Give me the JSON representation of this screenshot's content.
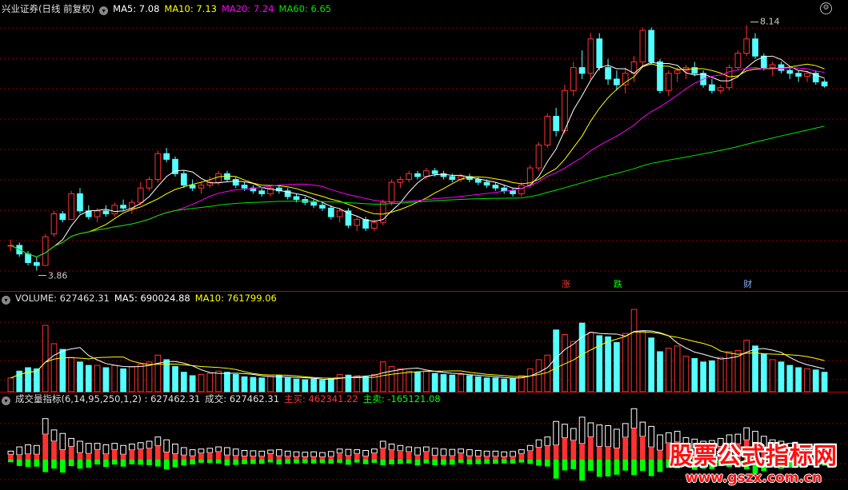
{
  "colors": {
    "up": "#ff3232",
    "down": "#54ffff",
    "ma5": "#ffffff",
    "ma10": "#ffff00",
    "ma20": "#ff00ff",
    "ma60": "#00e600",
    "grid": "#8b0000",
    "divider": "#c80000",
    "label_up": "#ff3232",
    "label_down": "#00ff00",
    "label_neutral": "#cccccc"
  },
  "price_header": {
    "title": "兴业证券(日线 前复权)",
    "ma5": "MA5: 7.08",
    "ma10": "MA10: 7.13",
    "ma20": "MA20: 7.24",
    "ma60": "MA60: 6.65"
  },
  "volume_header": {
    "label": "VOLUME: 627462.31",
    "ma5": "MA5: 690024.88",
    "ma10": "MA10: 761799.06"
  },
  "indicator_header": {
    "name": "成交量指标(6,14,95,250,1,2) : 627462.31",
    "volume": "成交: 627462.31",
    "buy": "主买: 462341.22",
    "sell": "主卖: -165121.08"
  },
  "icons": {
    "collapse": "chevron-down-icon",
    "settings": "gear-icon"
  },
  "events": [
    {
      "index": 64,
      "text": "涨",
      "color": "#ff3232"
    },
    {
      "index": 70,
      "text": "跌",
      "color": "#00ff00"
    },
    {
      "index": 85,
      "text": "财",
      "color": "#8ab0ff"
    }
  ],
  "watermark": {
    "main": "股票公式指标网",
    "url": "www.gszx.com.cn"
  },
  "chart_data": {
    "type": "candlestick",
    "price_ylim": [
      3.7,
      8.3
    ],
    "high_marker": {
      "index": 86,
      "value": 8.14,
      "label": "8.14"
    },
    "low_marker": {
      "index": 3,
      "value": 3.86,
      "label": "3.86"
    },
    "ohlc": [
      [
        4.3,
        4.4,
        4.2,
        4.3
      ],
      [
        4.3,
        4.35,
        4.1,
        4.15
      ],
      [
        4.15,
        4.2,
        3.95,
        4.0
      ],
      [
        4.0,
        4.1,
        3.86,
        3.95
      ],
      [
        3.95,
        4.5,
        3.95,
        4.45
      ],
      [
        4.5,
        4.9,
        4.45,
        4.85
      ],
      [
        4.85,
        4.9,
        4.7,
        4.75
      ],
      [
        4.75,
        5.25,
        4.75,
        5.2
      ],
      [
        5.2,
        5.3,
        4.85,
        4.9
      ],
      [
        4.9,
        5.0,
        4.75,
        4.8
      ],
      [
        4.8,
        4.95,
        4.7,
        4.9
      ],
      [
        4.9,
        5.0,
        4.8,
        4.85
      ],
      [
        4.85,
        5.05,
        4.8,
        5.0
      ],
      [
        5.0,
        5.1,
        4.9,
        4.95
      ],
      [
        4.95,
        5.1,
        4.85,
        5.05
      ],
      [
        5.05,
        5.4,
        5.0,
        5.3
      ],
      [
        5.3,
        5.5,
        5.25,
        5.45
      ],
      [
        5.45,
        5.95,
        5.4,
        5.9
      ],
      [
        5.9,
        6.0,
        5.75,
        5.8
      ],
      [
        5.8,
        5.85,
        5.5,
        5.55
      ],
      [
        5.55,
        5.6,
        5.3,
        5.35
      ],
      [
        5.35,
        5.45,
        5.25,
        5.3
      ],
      [
        5.3,
        5.4,
        5.2,
        5.35
      ],
      [
        5.35,
        5.5,
        5.3,
        5.4
      ],
      [
        5.4,
        5.6,
        5.35,
        5.55
      ],
      [
        5.55,
        5.6,
        5.4,
        5.45
      ],
      [
        5.45,
        5.5,
        5.3,
        5.35
      ],
      [
        5.35,
        5.4,
        5.25,
        5.3
      ],
      [
        5.3,
        5.35,
        5.2,
        5.25
      ],
      [
        5.25,
        5.3,
        5.15,
        5.2
      ],
      [
        5.2,
        5.35,
        5.15,
        5.3
      ],
      [
        5.3,
        5.35,
        5.2,
        5.25
      ],
      [
        5.25,
        5.3,
        5.1,
        5.15
      ],
      [
        5.15,
        5.2,
        5.05,
        5.1
      ],
      [
        5.1,
        5.15,
        5.0,
        5.05
      ],
      [
        5.05,
        5.1,
        4.95,
        5.0
      ],
      [
        5.0,
        5.05,
        4.9,
        4.95
      ],
      [
        4.95,
        5.0,
        4.75,
        4.8
      ],
      [
        4.8,
        4.95,
        4.7,
        4.9
      ],
      [
        4.9,
        4.95,
        4.6,
        4.65
      ],
      [
        4.65,
        4.8,
        4.55,
        4.75
      ],
      [
        4.75,
        4.8,
        4.55,
        4.6
      ],
      [
        4.6,
        4.75,
        4.55,
        4.7
      ],
      [
        4.7,
        5.1,
        4.65,
        5.05
      ],
      [
        5.05,
        5.45,
        5.0,
        5.4
      ],
      [
        5.4,
        5.5,
        5.3,
        5.45
      ],
      [
        5.45,
        5.6,
        5.4,
        5.55
      ],
      [
        5.55,
        5.6,
        5.45,
        5.5
      ],
      [
        5.5,
        5.65,
        5.45,
        5.6
      ],
      [
        5.6,
        5.65,
        5.5,
        5.55
      ],
      [
        5.55,
        5.6,
        5.45,
        5.5
      ],
      [
        5.5,
        5.55,
        5.4,
        5.45
      ],
      [
        5.45,
        5.55,
        5.4,
        5.5
      ],
      [
        5.5,
        5.55,
        5.4,
        5.45
      ],
      [
        5.45,
        5.5,
        5.35,
        5.4
      ],
      [
        5.4,
        5.45,
        5.3,
        5.35
      ],
      [
        5.35,
        5.4,
        5.25,
        5.3
      ],
      [
        5.3,
        5.35,
        5.2,
        5.25
      ],
      [
        5.25,
        5.3,
        5.15,
        5.2
      ],
      [
        5.2,
        5.4,
        5.15,
        5.35
      ],
      [
        5.35,
        5.7,
        5.3,
        5.65
      ],
      [
        5.65,
        6.1,
        5.6,
        6.05
      ],
      [
        6.05,
        6.6,
        6.0,
        6.55
      ],
      [
        6.55,
        6.7,
        6.2,
        6.3
      ],
      [
        6.3,
        7.1,
        6.25,
        7.0
      ],
      [
        7.0,
        7.5,
        6.9,
        7.4
      ],
      [
        7.4,
        7.7,
        7.2,
        7.3
      ],
      [
        7.3,
        8.0,
        7.2,
        7.9
      ],
      [
        7.9,
        8.0,
        7.35,
        7.4
      ],
      [
        7.4,
        7.55,
        7.1,
        7.2
      ],
      [
        7.2,
        7.35,
        7.0,
        7.1
      ],
      [
        7.1,
        7.4,
        6.95,
        7.3
      ],
      [
        7.3,
        7.6,
        7.15,
        7.5
      ],
      [
        7.5,
        8.1,
        7.4,
        8.05
      ],
      [
        8.05,
        8.1,
        7.45,
        7.5
      ],
      [
        7.5,
        7.55,
        6.95,
        7.0
      ],
      [
        7.0,
        7.35,
        6.9,
        7.3
      ],
      [
        7.3,
        7.4,
        7.15,
        7.35
      ],
      [
        7.35,
        7.45,
        7.2,
        7.4
      ],
      [
        7.4,
        7.5,
        7.25,
        7.3
      ],
      [
        7.3,
        7.35,
        7.05,
        7.1
      ],
      [
        7.1,
        7.2,
        6.95,
        7.0
      ],
      [
        7.0,
        7.1,
        6.95,
        7.05
      ],
      [
        7.05,
        7.45,
        7.0,
        7.4
      ],
      [
        7.4,
        7.7,
        7.35,
        7.65
      ],
      [
        7.65,
        8.14,
        7.6,
        7.9
      ],
      [
        7.9,
        8.0,
        7.55,
        7.6
      ],
      [
        7.6,
        7.65,
        7.35,
        7.4
      ],
      [
        7.4,
        7.5,
        7.25,
        7.45
      ],
      [
        7.45,
        7.5,
        7.3,
        7.35
      ],
      [
        7.35,
        7.4,
        7.2,
        7.3
      ],
      [
        7.3,
        7.35,
        7.15,
        7.25
      ],
      [
        7.25,
        7.35,
        7.15,
        7.3
      ],
      [
        7.3,
        7.35,
        7.1,
        7.15
      ],
      [
        7.15,
        7.2,
        7.05,
        7.08
      ]
    ],
    "volume": [
      120,
      180,
      210,
      200,
      580,
      420,
      370,
      300,
      260,
      230,
      230,
      210,
      230,
      200,
      220,
      240,
      260,
      320,
      280,
      220,
      170,
      140,
      150,
      160,
      180,
      170,
      150,
      130,
      125,
      120,
      135,
      140,
      120,
      110,
      105,
      110,
      100,
      115,
      150,
      145,
      140,
      130,
      150,
      260,
      220,
      200,
      180,
      170,
      180,
      160,
      150,
      145,
      150,
      140,
      130,
      120,
      120,
      110,
      115,
      140,
      200,
      280,
      320,
      540,
      500,
      440,
      600,
      520,
      490,
      480,
      430,
      510,
      720,
      530,
      470,
      350,
      380,
      400,
      310,
      290,
      260,
      270,
      300,
      350,
      360,
      450,
      400,
      330,
      280,
      260,
      230,
      210,
      200,
      190,
      170
    ]
  }
}
